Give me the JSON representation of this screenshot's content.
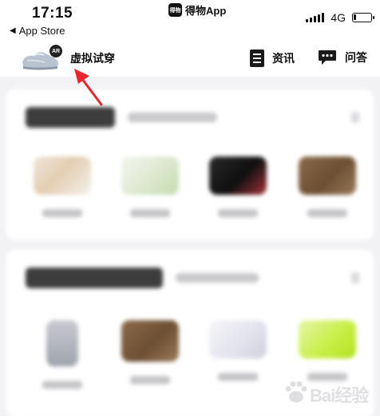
{
  "status_bar": {
    "time": "17:15",
    "back_label": "App Store",
    "app_name": "得物App",
    "app_logo_text": "得物",
    "network": "4G",
    "battery_percent": 15
  },
  "nav": {
    "try_on_label": "虚拟试穿",
    "ar_badge": "AR",
    "news_label": "资讯",
    "qa_label": "问答"
  },
  "colors": {
    "annotation_arrow": "#e8262d",
    "product_lime": "#c9ef4a"
  },
  "watermark": {
    "text": "Bai经验"
  }
}
